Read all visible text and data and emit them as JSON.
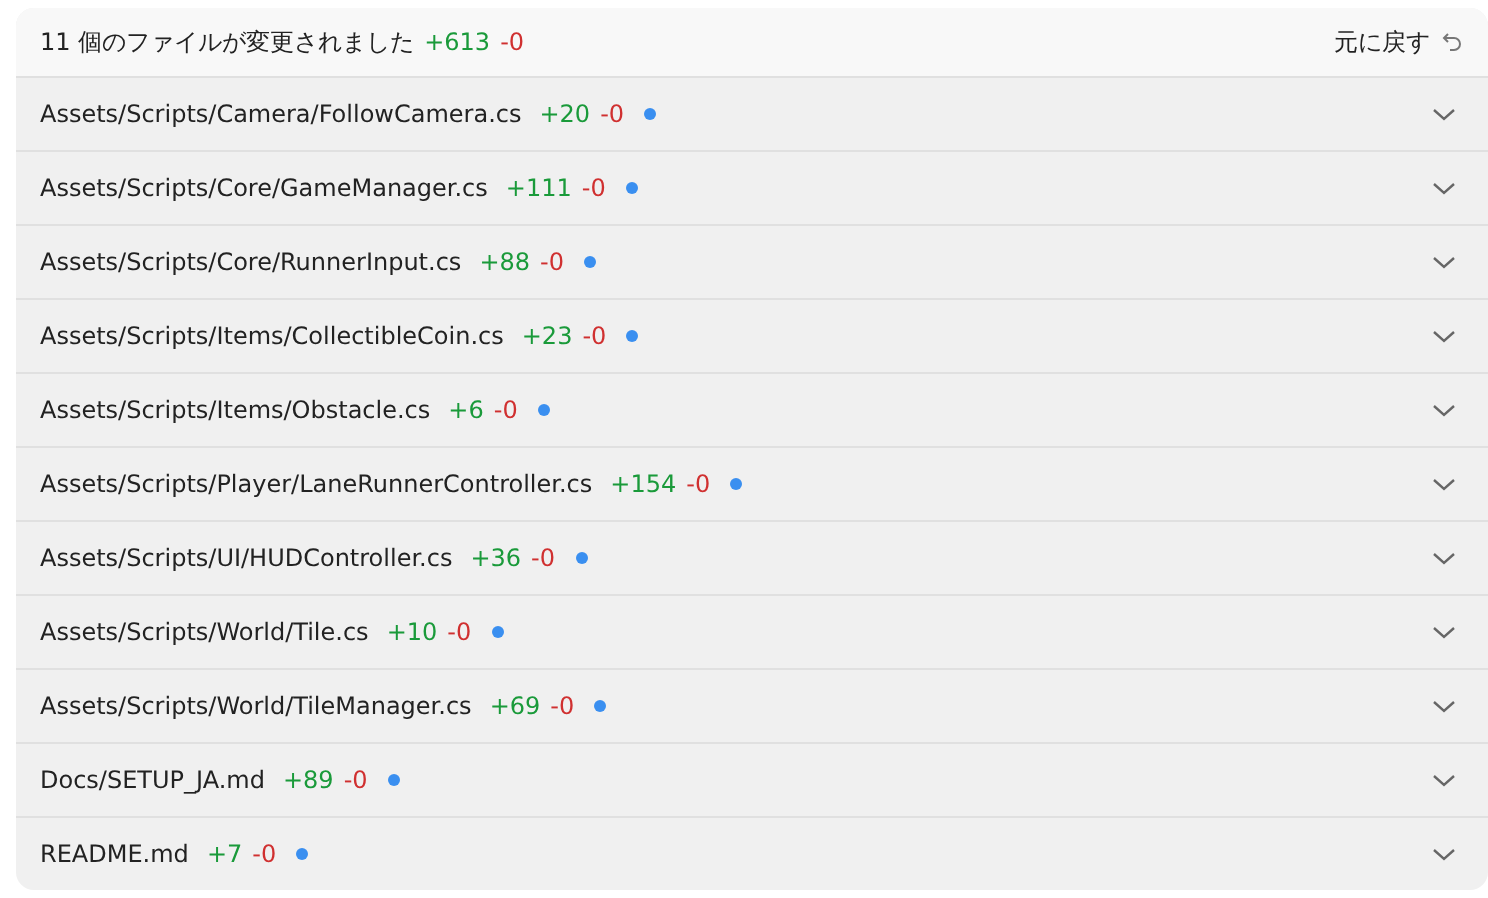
{
  "summary": {
    "text": "11 個のファイルが変更されました",
    "added": "+613",
    "removed": "-0"
  },
  "undo": {
    "label": "元に戻す"
  },
  "files": [
    {
      "path": "Assets/Scripts/Camera/FollowCamera.cs",
      "added": "+20",
      "removed": "-0",
      "modified": true,
      "expanded": false
    },
    {
      "path": "Assets/Scripts/Core/GameManager.cs",
      "added": "+111",
      "removed": "-0",
      "modified": true,
      "expanded": false
    },
    {
      "path": "Assets/Scripts/Core/RunnerInput.cs",
      "added": "+88",
      "removed": "-0",
      "modified": true,
      "expanded": false
    },
    {
      "path": "Assets/Scripts/Items/CollectibleCoin.cs",
      "added": "+23",
      "removed": "-0",
      "modified": true,
      "expanded": false
    },
    {
      "path": "Assets/Scripts/Items/Obstacle.cs",
      "added": "+6",
      "removed": "-0",
      "modified": true,
      "expanded": false
    },
    {
      "path": "Assets/Scripts/Player/LaneRunnerController.cs",
      "added": "+154",
      "removed": "-0",
      "modified": true,
      "expanded": false
    },
    {
      "path": "Assets/Scripts/UI/HUDController.cs",
      "added": "+36",
      "removed": "-0",
      "modified": true,
      "expanded": false
    },
    {
      "path": "Assets/Scripts/World/Tile.cs",
      "added": "+10",
      "removed": "-0",
      "modified": true,
      "expanded": false
    },
    {
      "path": "Assets/Scripts/World/TileManager.cs",
      "added": "+69",
      "removed": "-0",
      "modified": true,
      "expanded": false
    },
    {
      "path": "Docs/SETUP_JA.md",
      "added": "+89",
      "removed": "-0",
      "modified": true,
      "expanded": false
    },
    {
      "path": "README.md",
      "added": "+7",
      "removed": "-0",
      "modified": true,
      "expanded": false
    }
  ]
}
